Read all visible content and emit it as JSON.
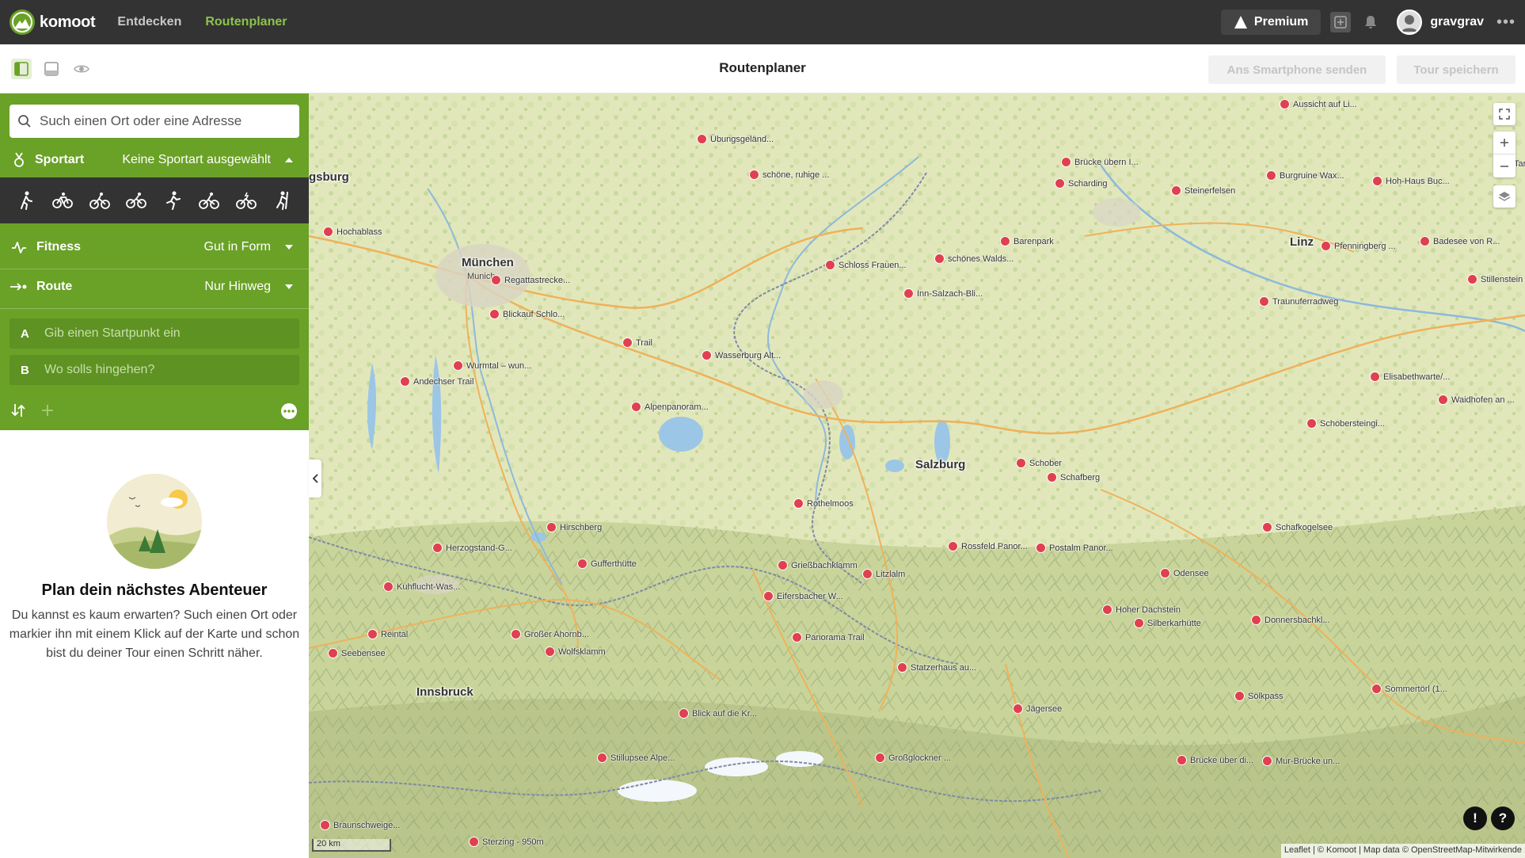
{
  "topnav": {
    "logo_text": "komoot",
    "links": [
      "Entdecken",
      "Routenplaner"
    ],
    "premium": "Premium",
    "user": "gravgrav",
    "more": "•••"
  },
  "toolbar": {
    "title": "Routenplaner",
    "send_btn": "Ans Smartphone senden",
    "save_btn": "Tour speichern"
  },
  "sidebar": {
    "search_placeholder": "Such einen Ort oder eine Adresse",
    "sport_label": "Sportart",
    "sport_value": "Keine Sportart ausgewählt",
    "fitness_label": "Fitness",
    "fitness_value": "Gut in Form",
    "route_label": "Route",
    "route_value": "Nur Hinweg",
    "wp_a_letter": "A",
    "wp_a_placeholder": "Gib einen Startpunkt ein",
    "wp_b_letter": "B",
    "wp_b_placeholder": "Wo solls hingehen?",
    "empty_title": "Plan dein nächstes Abenteuer",
    "empty_text": "Du kannst es kaum erwarten? Such einen Ort oder markier ihn mit einem Klick auf der Karte und schon bist du deiner Tour einen Schritt näher."
  },
  "map": {
    "cities": [
      "gsburg",
      "München",
      "Munich",
      "Salzburg",
      "Linz",
      "Innsbruck"
    ],
    "pois": [
      "Aussicht auf Li...",
      "Übungsgeländ...",
      "Brücke übern I...",
      "Scharding",
      "schöne, ruhige ...",
      "Steinerfelsen",
      "Burgruine Wax...",
      "Hoh-Haus Buc...",
      "Tann",
      "Hochablass",
      "Barenpark",
      "schönes Walds...",
      "Schloss Frauen...",
      "Pfenningberg ...",
      "Badesee von R...",
      "Stillenstein",
      "Regattastrecke...",
      "Inn-Salzach-Bli...",
      "Traunuferradweg",
      "Blickauf Schlo...",
      "Trail",
      "Wasserburg Alt...",
      "Wurmtal – wun...",
      "Andechser Trail",
      "Elisabethwarte/...",
      "Waidhofen an ...",
      "Alpenpanoram...",
      "Schobersteingi...",
      "Schober",
      "Schafberg",
      "Rothelmoos",
      "Hirschberg",
      "Schafkogelsee",
      "Herzogstand-G...",
      "Rossfeld Panor...",
      "Postalm Panor...",
      "Gufferthütte",
      "Grießbachklamm",
      "Litzlalm",
      "Odensee",
      "Kuhflucht-Was...",
      "Eifersbacher W...",
      "Hoher Dachstein",
      "Silberkarhütte",
      "Donnersbachkl...",
      "Reintal",
      "Großer Ahornb...",
      "Panorama Trail",
      "Seebensee",
      "Wolfsklamm",
      "Statzerhaus au...",
      "Sölkpass",
      "Sommertörl (1...",
      "Jägersee",
      "Blick auf die Kr...",
      "Stillupsee Alpe...",
      "Großglockner ...",
      "Brücke über di...",
      "Mur-Brücke un...",
      "Braunschweige...",
      "Sterzing - 950m"
    ],
    "scale": "20 km",
    "attribution": "Leaflet | © Komoot | Map data © OpenStreetMap-Mitwirkende"
  },
  "colors": {
    "brand_green": "#6aa127",
    "nav_bg": "#333333",
    "poi_red": "#e0404f"
  }
}
